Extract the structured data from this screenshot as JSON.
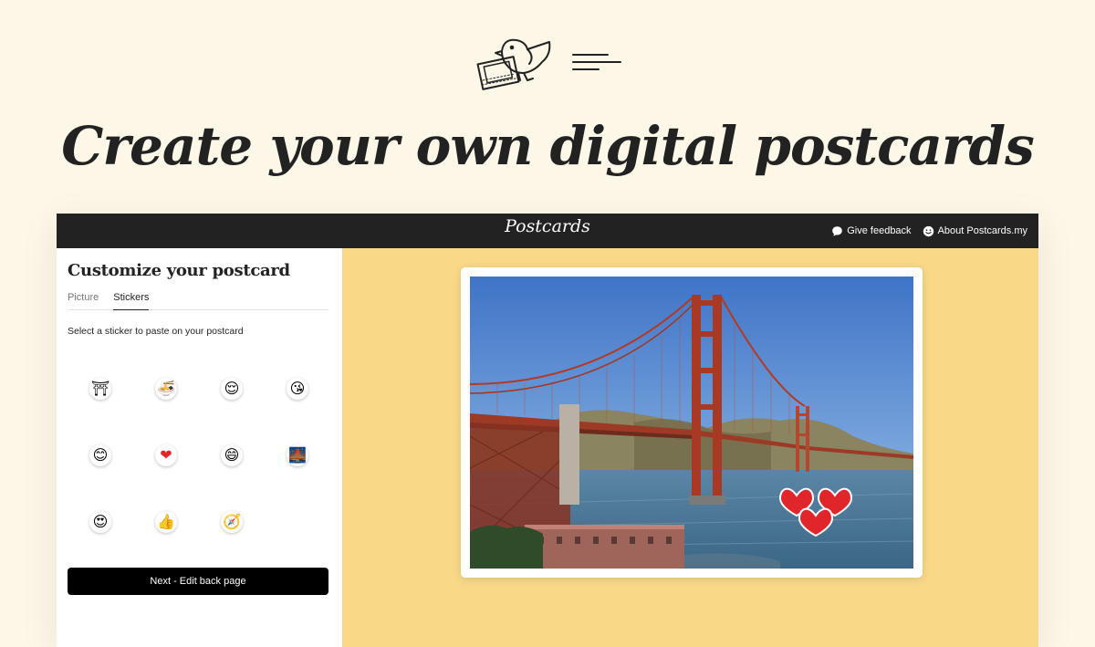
{
  "hero": {
    "logo_icon": "bird-carrying-postcard-icon",
    "title": "Create your own digital postcards"
  },
  "topbar": {
    "brand": "Postcards",
    "links": [
      {
        "icon": "chat-bubble-icon",
        "label": "Give feedback"
      },
      {
        "icon": "smiley-icon",
        "label": "About Postcards.my"
      }
    ]
  },
  "sidebar": {
    "title": "Customize your postcard",
    "tabs": [
      {
        "label": "Picture",
        "active": false
      },
      {
        "label": "Stickers",
        "active": true
      }
    ],
    "hint": "Select a sticker to paste on your postcard",
    "stickers": [
      "⛩",
      "🍜",
      "😌",
      "😘",
      "😊",
      "❤",
      "😄",
      "🌉",
      "😍",
      "👍",
      "🧭"
    ],
    "next_button": "Next - Edit back page"
  },
  "preview": {
    "photo_subject": "golden-gate-bridge-photo",
    "placed_sticker": "hearts-sticker"
  },
  "colors": {
    "page_bg": "#fdf7e8",
    "topbar_bg": "#222222",
    "preview_bg": "#f9d988",
    "button_bg": "#000000"
  }
}
